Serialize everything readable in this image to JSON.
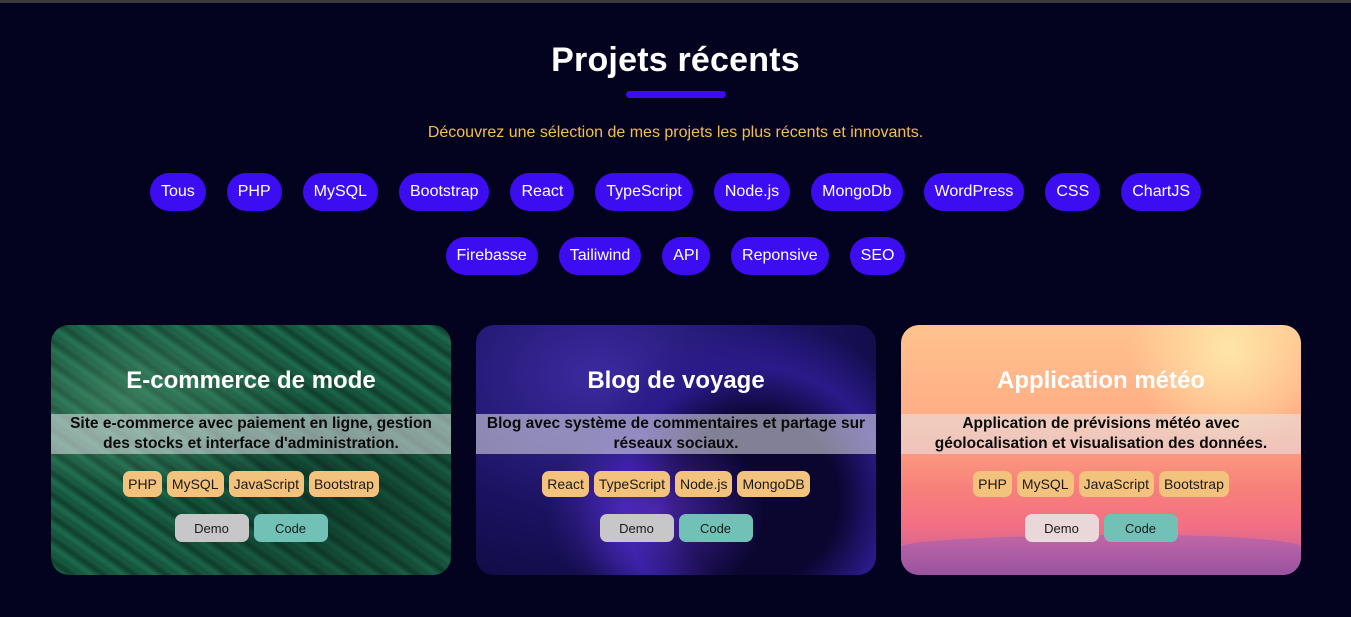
{
  "section": {
    "title": "Projets récents",
    "subtitle": "Découvrez une sélection de mes projets les plus récents et innovants."
  },
  "filters": [
    "Tous",
    "PHP",
    "MySQL",
    "Bootstrap",
    "React",
    "TypeScript",
    "Node.js",
    "MongoDb",
    "WordPress",
    "CSS",
    "ChartJS",
    "Firebasse",
    "Tailiwind",
    "API",
    "Reponsive",
    "SEO"
  ],
  "projects": [
    {
      "title": "E-commerce de mode",
      "description": "Site e-commerce avec paiement en ligne, gestion des stocks et interface d'administration.",
      "tags": [
        "PHP",
        "MySQL",
        "JavaScript",
        "Bootstrap"
      ],
      "demo_label": "Demo",
      "code_label": "Code"
    },
    {
      "title": "Blog de voyage",
      "description": "Blog avec système de commentaires et partage sur réseaux sociaux.",
      "tags": [
        "React",
        "TypeScript",
        "Node.js",
        "MongoDB"
      ],
      "demo_label": "Demo",
      "code_label": "Code"
    },
    {
      "title": "Application météo",
      "description": "Application de prévisions météo avec géolocalisation et visualisation des données.",
      "tags": [
        "PHP",
        "MySQL",
        "JavaScript",
        "Bootstrap"
      ],
      "demo_label": "Demo",
      "code_label": "Code"
    }
  ],
  "colors": {
    "background": "#03021f",
    "accent": "#3b0df0",
    "subtitle": "#f5c04a",
    "tag": "#f3c27d",
    "code_button": "#71c1b7",
    "demo_button": "#c7c7c9"
  }
}
